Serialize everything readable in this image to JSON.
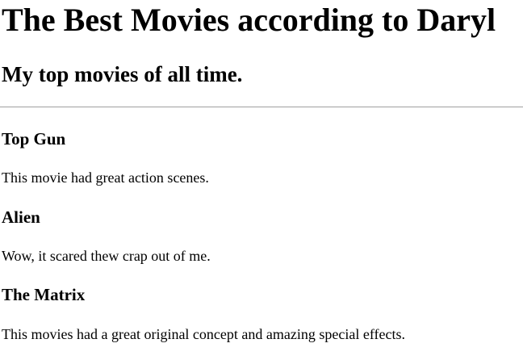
{
  "page": {
    "title": "The Best Movies according to Daryl",
    "subtitle": "My top movies of all time."
  },
  "movies": [
    {
      "title": "Top Gun",
      "description": "This movie had great action scenes."
    },
    {
      "title": "Alien",
      "description": "Wow, it scared thew crap out of me."
    },
    {
      "title": "The Matrix",
      "description": "This movies had a great original concept and amazing special effects."
    }
  ]
}
